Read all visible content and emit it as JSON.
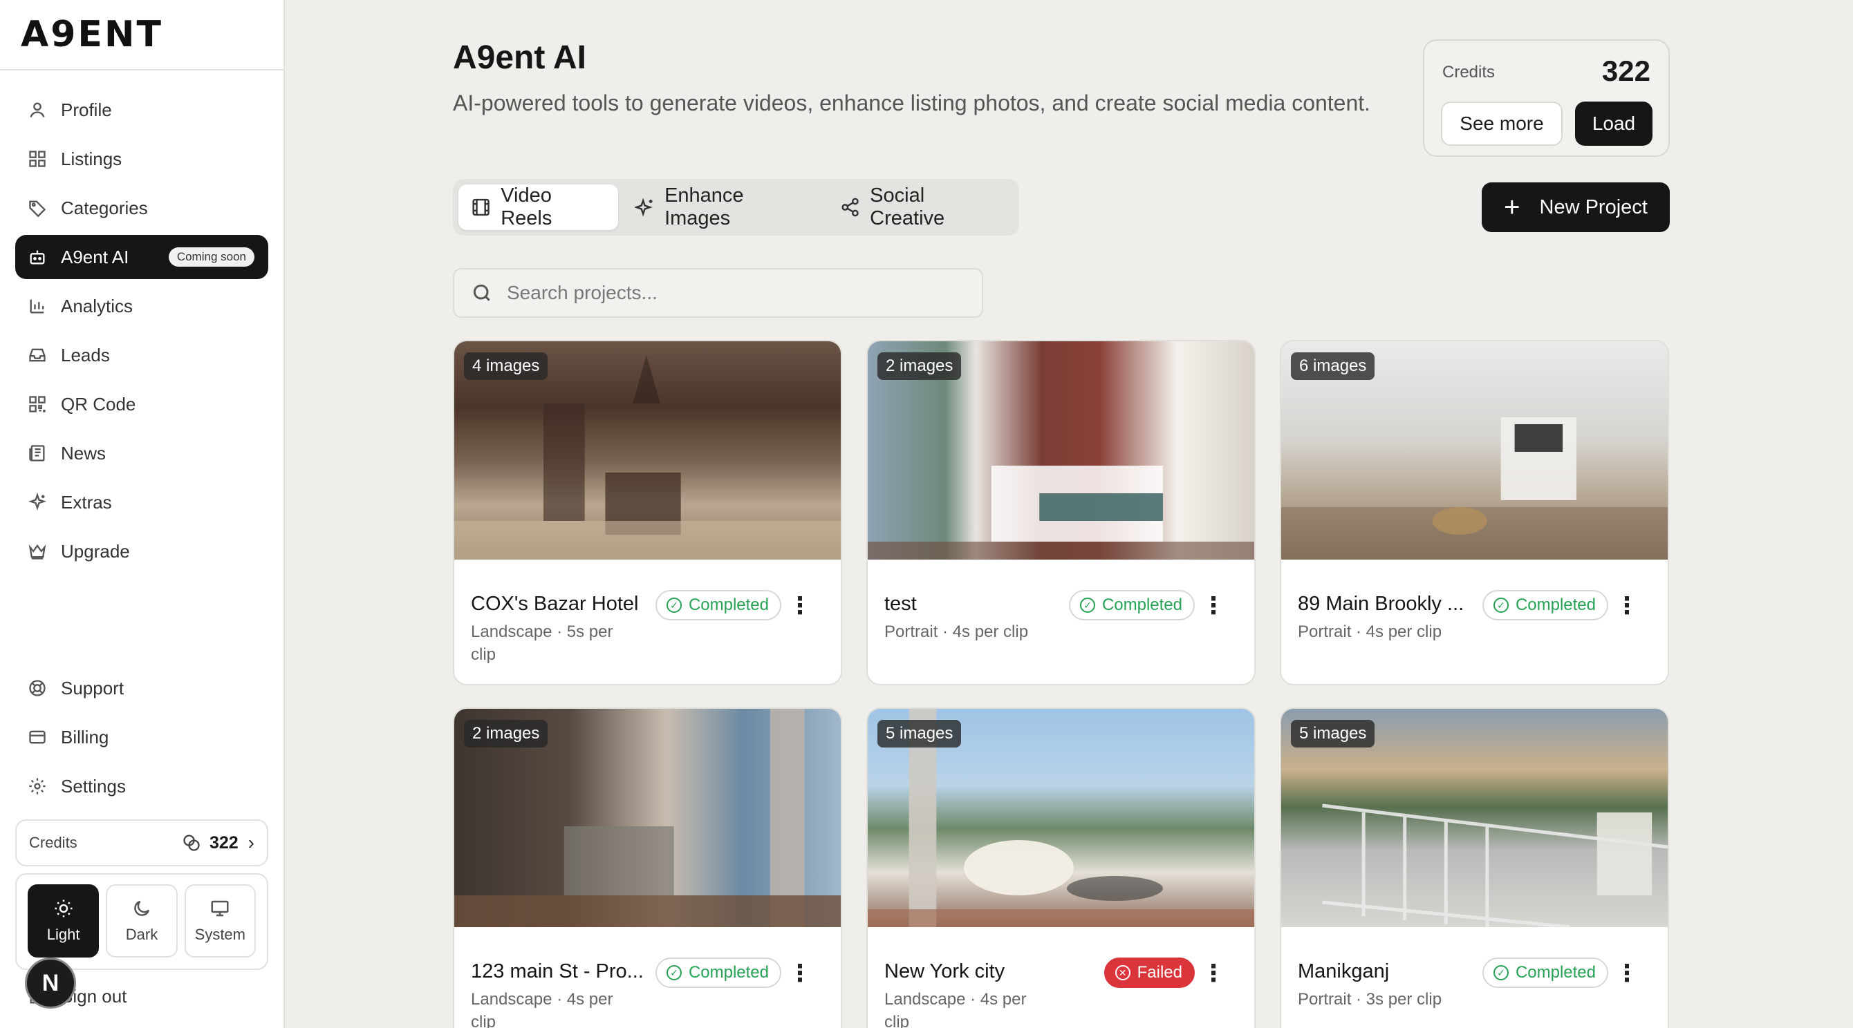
{
  "app": {
    "logo": "A9ENT"
  },
  "sidebar": {
    "items": [
      {
        "label": "Profile",
        "icon": "user-icon"
      },
      {
        "label": "Listings",
        "icon": "grid-icon"
      },
      {
        "label": "Categories",
        "icon": "tag-icon"
      },
      {
        "label": "A9ent AI",
        "icon": "robot-icon",
        "badge": "Coming soon",
        "active": true
      },
      {
        "label": "Analytics",
        "icon": "bar-chart-icon"
      },
      {
        "label": "Leads",
        "icon": "inbox-icon"
      },
      {
        "label": "QR Code",
        "icon": "qr-code-icon"
      },
      {
        "label": "News",
        "icon": "newspaper-icon"
      },
      {
        "label": "Extras",
        "icon": "sparkles-icon"
      },
      {
        "label": "Upgrade",
        "icon": "crown-icon"
      }
    ],
    "bottom_items": [
      {
        "label": "Support",
        "icon": "lifebuoy-icon"
      },
      {
        "label": "Billing",
        "icon": "credit-card-icon"
      },
      {
        "label": "Settings",
        "icon": "gear-icon"
      }
    ],
    "credits": {
      "label": "Credits",
      "value": "322"
    },
    "theme": {
      "light": "Light",
      "dark": "Dark",
      "system": "System",
      "selected": "Light"
    },
    "signout": "Sign out",
    "avatar_letter": "N"
  },
  "header": {
    "title": "A9ent AI",
    "subtitle": "AI-powered tools to generate videos, enhance listing photos, and create social media content."
  },
  "credits_card": {
    "label": "Credits",
    "value": "322",
    "see_more": "See more",
    "load": "Load"
  },
  "tabs": [
    {
      "label": "Video Reels",
      "icon": "film-icon",
      "active": true
    },
    {
      "label": "Enhance Images",
      "icon": "sparkles-icon"
    },
    {
      "label": "Social Creative",
      "icon": "share-icon"
    }
  ],
  "new_project": "New Project",
  "search": {
    "placeholder": "Search projects..."
  },
  "projects": [
    {
      "name": "COX's Bazar Hotel",
      "meta": "Landscape · 5s per clip",
      "images": "4 images",
      "status": "Completed"
    },
    {
      "name": "test",
      "meta": "Portrait · 4s per clip",
      "images": "2 images",
      "status": "Completed"
    },
    {
      "name": "89 Main Brookly ...",
      "meta": "Portrait · 4s per clip",
      "images": "6 images",
      "status": "Completed"
    },
    {
      "name": "123 main St - Pro...",
      "meta": "Landscape · 4s per clip",
      "images": "2 images",
      "status": "Completed"
    },
    {
      "name": "New York city",
      "meta": "Landscape · 4s per clip",
      "images": "5 images",
      "status": "Failed"
    },
    {
      "name": "Manikganj",
      "meta": "Portrait · 3s per clip",
      "images": "5 images",
      "status": "Completed"
    }
  ],
  "colors": {
    "accent": "#161616",
    "completed": "#26a255",
    "failed": "#d9353b",
    "background": "#efeeea"
  }
}
